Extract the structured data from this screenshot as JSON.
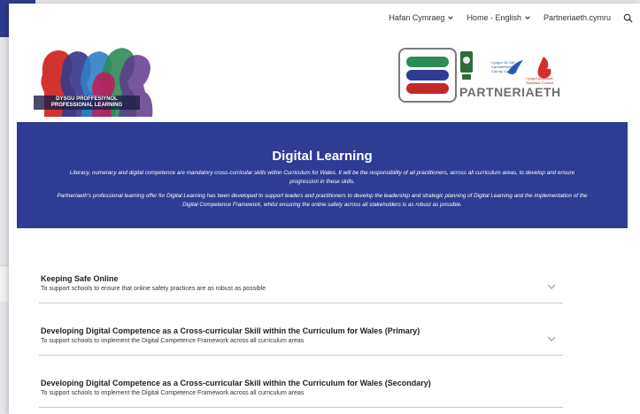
{
  "nav": {
    "items": [
      {
        "label": "Hafan Cymraeg",
        "has_dropdown": true
      },
      {
        "label": "Home - English",
        "has_dropdown": true
      },
      {
        "label": "Partneriaeth.cymru",
        "has_dropdown": false
      }
    ],
    "search_icon": "search-icon"
  },
  "logo_left": {
    "line1": "DYSGU PROFFESIYNOL",
    "line2": "PROFESSIONAL LEARNING"
  },
  "logo_right": {
    "brand_word": "PARTNERIAETH",
    "council": "Cyngor Sir Gâr Carmarthenshire County Council",
    "swansea": "Cyngor Abertawe Swansea Council"
  },
  "banner": {
    "title": "Digital Learning",
    "paragraph1": "Literacy, numeracy and digital competence are mandatory cross-curricular skills within Curriculum for Wales. It will be the responsibility of all practitioners, across all curriculum areas, to develop and ensure progression in these skills.",
    "paragraph2": "Partneriaeth's professional learning offer for Digital Learning has been developed to support leaders and practitioners to develop the leadership and strategic planning of Digital Learning and the implementation of the Digital Competence Framework, whilst ensuring the online safety across all stakeholders is as robust as possible."
  },
  "accordion": [
    {
      "title": "Keeping Safe Online",
      "subtitle": "To support schools to ensure that online safety practices are as robust as possible"
    },
    {
      "title": "Developing Digital Competence as a Cross-curricular Skill within the Curriculum for Wales (Primary)",
      "subtitle": "To support schools to implement the Digital Competence Framework across all curriculum areas"
    },
    {
      "title": "Developing Digital Competence as a Cross-curricular Skill within the Curriculum for Wales (Secondary)",
      "subtitle": "To support schools to implement the Digital Competence Framework across all curriculum areas"
    }
  ],
  "colors": {
    "banner": "#2f3c93",
    "brand_green": "#2e8b57",
    "brand_blue": "#2f3c93",
    "brand_red": "#c62828"
  }
}
